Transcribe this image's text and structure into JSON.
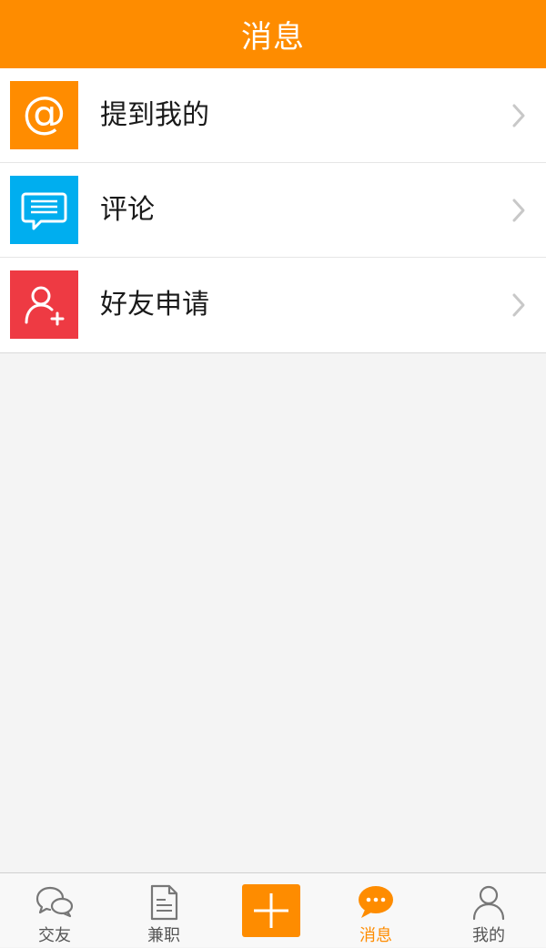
{
  "header": {
    "title": "消息"
  },
  "colors": {
    "brand": "#fe8c00",
    "mention_icon_bg": "#ff8c00",
    "comment_icon_bg": "#00aeef",
    "friend_request_icon_bg": "#ee3a43"
  },
  "rows": [
    {
      "label": "提到我的",
      "icon": "at-sign-icon"
    },
    {
      "label": "评论",
      "icon": "comment-icon"
    },
    {
      "label": "好友申请",
      "icon": "add-friend-icon"
    }
  ],
  "tabbar": {
    "tabs": [
      {
        "label": "交友",
        "icon": "chat-bubbles-icon",
        "active": false
      },
      {
        "label": "兼职",
        "icon": "document-icon",
        "active": false
      },
      {
        "label": "",
        "icon": "plus-icon",
        "active": false
      },
      {
        "label": "消息",
        "icon": "message-dots-icon",
        "active": true
      },
      {
        "label": "我的",
        "icon": "user-icon",
        "active": false
      }
    ]
  }
}
